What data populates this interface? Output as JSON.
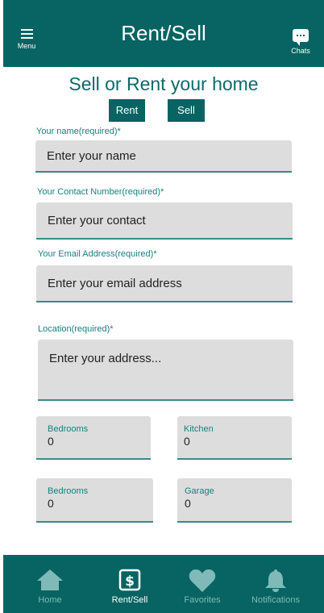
{
  "header": {
    "menu_label": "Menu",
    "title": "Rent/Sell",
    "chats_label": "Chats"
  },
  "form": {
    "heading": "Sell or Rent your home",
    "toggle_rent": "Rent",
    "toggle_sell": "Sell",
    "name_label": "Your name(required)*",
    "name_placeholder": "Enter your name",
    "contact_label": "Your Contact Number(required)*",
    "contact_placeholder": "Enter your contact",
    "email_label": "Your Email Address(required)*",
    "email_placeholder": "Enter your email address",
    "location_label": "Location(required)*",
    "location_placeholder": "Enter your address...",
    "counts": [
      {
        "label": "Bedrooms",
        "value": "0"
      },
      {
        "label": "Kitchen",
        "value": "0"
      },
      {
        "label": "Bedrooms",
        "value": "0"
      },
      {
        "label": "Garage",
        "value": "0"
      }
    ]
  },
  "nav": {
    "home": "Home",
    "rent_sell": "Rent/Sell",
    "favorites": "Favorites",
    "notifications": "Notifications",
    "active_color": "#ffffff",
    "inactive_color": "#7fbab8"
  },
  "colors": {
    "primary": "#076462",
    "accent_text": "#17807e",
    "field_bg": "#dddddd"
  }
}
